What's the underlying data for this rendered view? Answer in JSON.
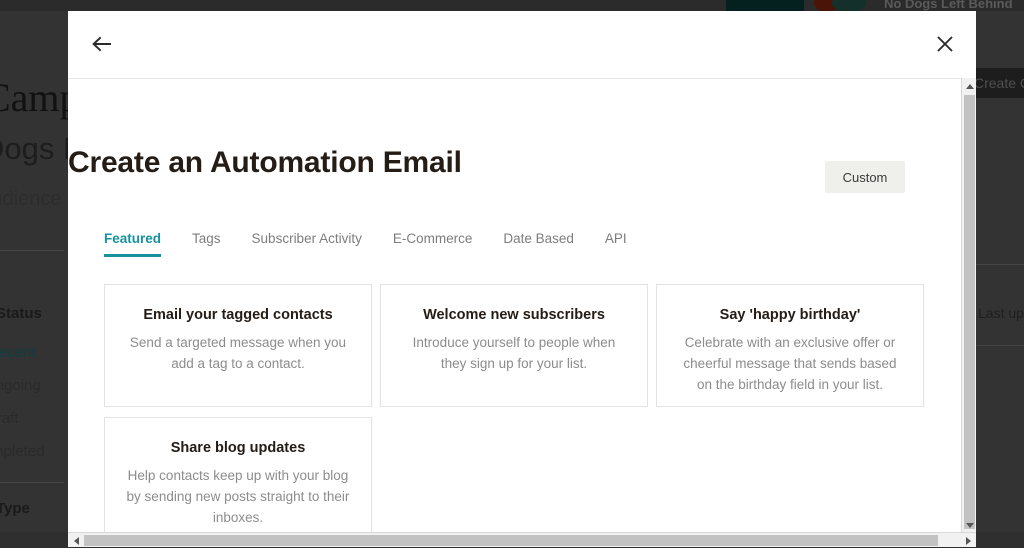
{
  "background": {
    "brand_name": "No Dogs Left Behind",
    "heading_big": "Campa",
    "heading_sub": "Dogs Le",
    "audience_label": "Audience",
    "create_button": "Create Ca",
    "last_updated_header": "Last upd",
    "filters": [
      {
        "title": "Status",
        "items": [
          "Recent",
          "Ongoing",
          "Draft",
          "Completed"
        ],
        "active_index": 0
      },
      {
        "title": "Type",
        "items": []
      }
    ]
  },
  "modal": {
    "back_icon": "arrow-left-icon",
    "close_icon": "close-icon",
    "title": "Create an Automation Email",
    "custom_button": "Custom",
    "tabs": [
      {
        "label": "Featured",
        "active": true
      },
      {
        "label": "Tags",
        "active": false
      },
      {
        "label": "Subscriber Activity",
        "active": false
      },
      {
        "label": "E-Commerce",
        "active": false
      },
      {
        "label": "Date Based",
        "active": false
      },
      {
        "label": "API",
        "active": false
      }
    ],
    "cards": [
      {
        "title": "Email your tagged contacts",
        "description": "Send a targeted message when you add a tag to a contact."
      },
      {
        "title": "Welcome new subscribers",
        "description": "Introduce yourself to people when they sign up for your list."
      },
      {
        "title": "Say 'happy birthday'",
        "description": "Celebrate with an exclusive offer or cheerful message that sends based on the birthday field in your list."
      },
      {
        "title": "Share blog updates",
        "description": "Help contacts keep up with your blog by sending new posts straight to their inboxes."
      }
    ]
  },
  "colors": {
    "accent_teal": "#17919e",
    "title_text": "#241c15",
    "muted_text": "#8c8c8c",
    "custom_button_bg": "#efefeb",
    "card_border": "#e3e3e3",
    "overlay": "#333333"
  },
  "scrollbars": {
    "vertical_up_icon": "triangle-up-icon",
    "vertical_down_icon": "triangle-down-icon",
    "horizontal_left_icon": "triangle-left-icon",
    "horizontal_right_icon": "triangle-right-icon"
  }
}
